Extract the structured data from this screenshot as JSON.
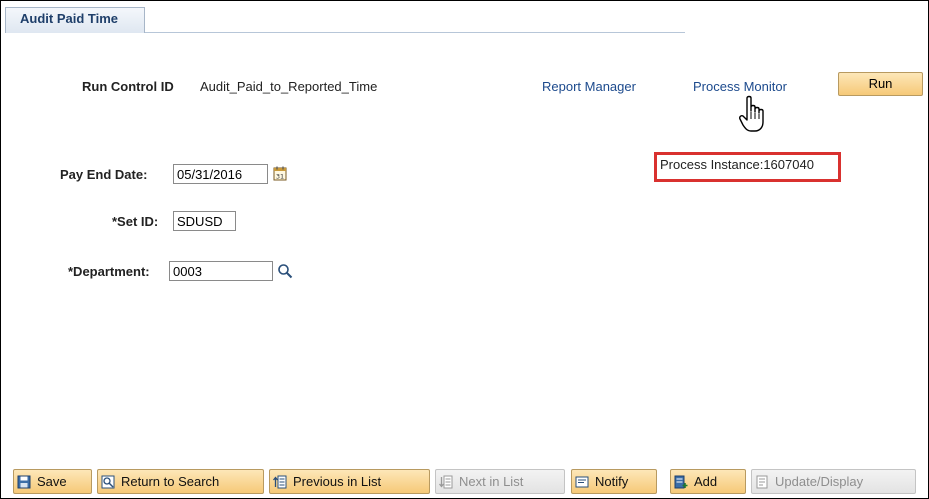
{
  "tab": {
    "label": "Audit Paid Time"
  },
  "run_control": {
    "label": "Run Control ID",
    "value": "Audit_Paid_to_Reported_Time"
  },
  "links": {
    "report_manager": "Report Manager",
    "process_monitor": "Process Monitor"
  },
  "run_button": {
    "label": "Run"
  },
  "process_instance": {
    "text": "Process Instance:1607040"
  },
  "fields": {
    "pay_end_date": {
      "label": "Pay End Date:",
      "value": "05/31/2016"
    },
    "set_id": {
      "label": "*Set ID:",
      "value": "SDUSD"
    },
    "department": {
      "label": "*Department:",
      "value": "0003"
    }
  },
  "toolbar": {
    "save": "Save",
    "return_to_search": "Return to Search",
    "previous_in_list": "Previous in List",
    "next_in_list": "Next in List",
    "notify": "Notify",
    "add": "Add",
    "update_display": "Update/Display"
  },
  "colors": {
    "link": "#1c4a8d",
    "highlight_border": "#d9312f",
    "button_gradient_top": "#fde7b8",
    "button_gradient_bottom": "#f6c978"
  }
}
